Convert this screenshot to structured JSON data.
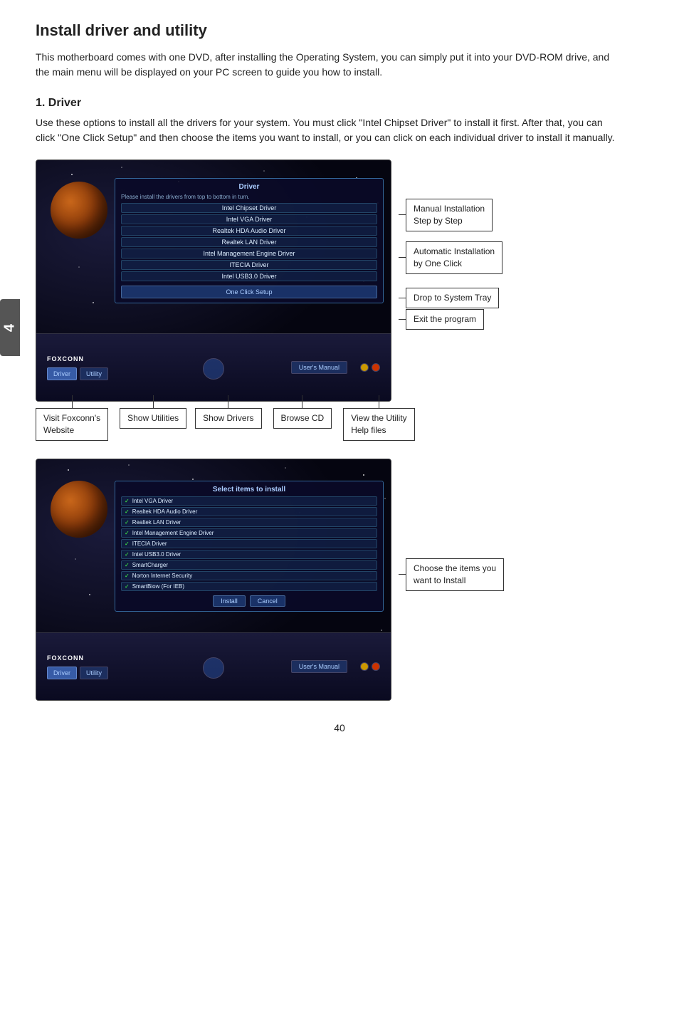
{
  "page": {
    "title": "Install driver and utility",
    "intro": "This motherboard comes with one DVD, after installing the Operating System, you can simply put it into your DVD-ROM drive, and the main menu will be displayed on your PC screen to guide you how to install.",
    "section1": {
      "heading": "1. Driver",
      "description": "Use these options to install all the drivers for your system. You must click \"Intel Chipset Driver\" to install it first. After that, you can click \"One Click Setup\" and then choose the items you want to install, or you can click on each individual driver to install it manually."
    },
    "screenshot1": {
      "panel_title": "Driver",
      "instruction": "Please install the drivers from top to bottom in turn.",
      "drivers": [
        "Intel Chipset Driver",
        "Intel VGA Driver",
        "Realtek HDA Audio Driver",
        "Realtek LAN Driver",
        "Intel Management Engine Driver",
        "ITECIA Driver",
        "Intel USB3.0 Driver"
      ],
      "one_click_btn": "One Click Setup",
      "foxconn_label": "FOXCONN",
      "nav_btns": [
        "Driver",
        "Utility"
      ],
      "manual_btn": "User's Manual",
      "callouts": {
        "manual": "Manual Installation\nStep by Step",
        "automatic": "Automatic Installation\nby One Click",
        "tray": "Drop to System Tray",
        "exit": "Exit the program"
      }
    },
    "screenshot1_bottom_labels": [
      "Visit Foxconn's\nWebsite",
      "Show Utilities",
      "Show Drivers",
      "Browse CD",
      "View the Utility\nHelp files"
    ],
    "screenshot2": {
      "panel_title": "Select items to install",
      "items": [
        "Intel VGA Driver",
        "Realtek HDA Audio Driver",
        "Realtek LAN Driver",
        "Intel Management Engine Driver",
        "ITECIA Driver",
        "Intel USB3.0 Driver",
        "SmartCharger",
        "Norton Internet Security",
        "SmartBiow (For IEB)"
      ],
      "install_btn": "Install",
      "cancel_btn": "Cancel",
      "foxconn_label": "FOXCONN",
      "nav_btns": [
        "Driver",
        "Utility"
      ],
      "manual_btn": "User's Manual",
      "callout": "Choose the items you\nwant to Install"
    },
    "page_number": "40",
    "side_tab": "4"
  }
}
